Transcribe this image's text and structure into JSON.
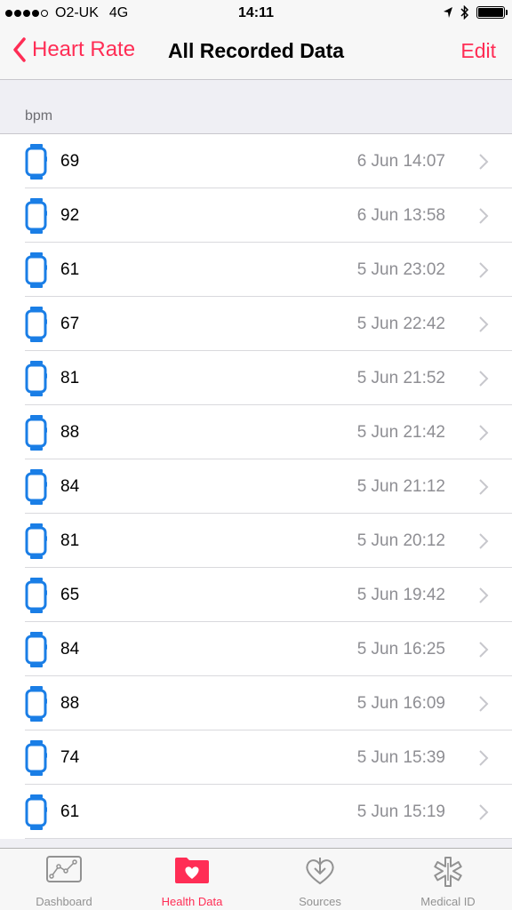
{
  "status_bar": {
    "carrier": "O2-UK",
    "network": "4G",
    "time": "14:11"
  },
  "nav": {
    "back_label": "Heart Rate",
    "title": "All Recorded Data",
    "edit_label": "Edit"
  },
  "section": {
    "header": "bpm"
  },
  "records": [
    {
      "value": "69",
      "date": "6 Jun 14:07"
    },
    {
      "value": "92",
      "date": "6 Jun 13:58"
    },
    {
      "value": "61",
      "date": "5 Jun 23:02"
    },
    {
      "value": "67",
      "date": "5 Jun 22:42"
    },
    {
      "value": "81",
      "date": "5 Jun 21:52"
    },
    {
      "value": "88",
      "date": "5 Jun 21:42"
    },
    {
      "value": "84",
      "date": "5 Jun 21:12"
    },
    {
      "value": "81",
      "date": "5 Jun 20:12"
    },
    {
      "value": "65",
      "date": "5 Jun 19:42"
    },
    {
      "value": "84",
      "date": "5 Jun 16:25"
    },
    {
      "value": "88",
      "date": "5 Jun 16:09"
    },
    {
      "value": "74",
      "date": "5 Jun 15:39"
    },
    {
      "value": "61",
      "date": "5 Jun 15:19"
    }
  ],
  "tabs": [
    {
      "label": "Dashboard",
      "icon": "chart-icon"
    },
    {
      "label": "Health Data",
      "icon": "heart-folder-icon"
    },
    {
      "label": "Sources",
      "icon": "heart-download-icon"
    },
    {
      "label": "Medical ID",
      "icon": "medical-star-icon"
    }
  ],
  "colors": {
    "accent": "#ff2d55",
    "watch_icon": "#1a7ee6",
    "secondary_text": "#8e8e93"
  }
}
